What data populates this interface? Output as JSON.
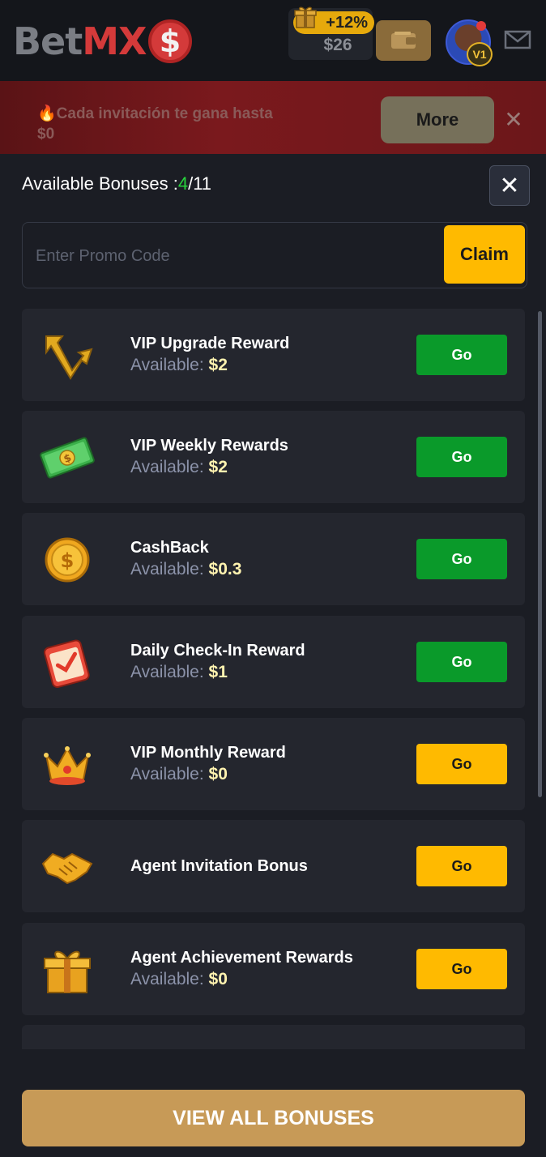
{
  "header": {
    "logo_part1": "Bet",
    "logo_part2": "MX",
    "logo_coin": "$",
    "bonus_percent": "+12%",
    "balance": "$26",
    "vip_level": "V1"
  },
  "banner": {
    "text": "🔥Cada invitación te gana hasta $0",
    "more_label": "More",
    "close_label": "✕"
  },
  "panel": {
    "title_prefix": "Available Bonuses :",
    "available_count": "4",
    "total_count": "/11",
    "close_label": "✕"
  },
  "promo": {
    "placeholder": "Enter Promo Code",
    "claim_label": "Claim"
  },
  "bonuses": [
    {
      "name": "VIP Upgrade Reward",
      "available_label": "Available: ",
      "amount": "$2",
      "button": "Go",
      "button_color": "green",
      "icon": "upgrade-arrow-icon"
    },
    {
      "name": "VIP Weekly Rewards",
      "available_label": "Available: ",
      "amount": "$2",
      "button": "Go",
      "button_color": "green",
      "icon": "cash-bill-icon"
    },
    {
      "name": "CashBack",
      "available_label": "Available: ",
      "amount": "$0.3",
      "button": "Go",
      "button_color": "green",
      "icon": "gold-coin-icon"
    },
    {
      "name": "Daily Check-In Reward",
      "available_label": "Available: ",
      "amount": "$1",
      "button": "Go",
      "button_color": "green",
      "icon": "calendar-check-icon"
    },
    {
      "name": "VIP Monthly Reward",
      "available_label": "Available: ",
      "amount": "$0",
      "button": "Go",
      "button_color": "yellow",
      "icon": "crown-icon"
    },
    {
      "name": "Agent Invitation Bonus",
      "available_label": "",
      "amount": "",
      "button": "Go",
      "button_color": "yellow",
      "icon": "handshake-icon"
    },
    {
      "name": "Agent Achievement Rewards",
      "available_label": "Available: ",
      "amount": "$0",
      "button": "Go",
      "button_color": "yellow",
      "icon": "gift-box-icon"
    }
  ],
  "footer": {
    "view_all_label": "VIEW ALL BONUSES"
  },
  "colors": {
    "background": "#1b1d24",
    "card": "#24262e",
    "green": "#0a9a2a",
    "yellow": "#ffba00",
    "gold_button": "#c79a57",
    "available_count": "#27d43c"
  }
}
